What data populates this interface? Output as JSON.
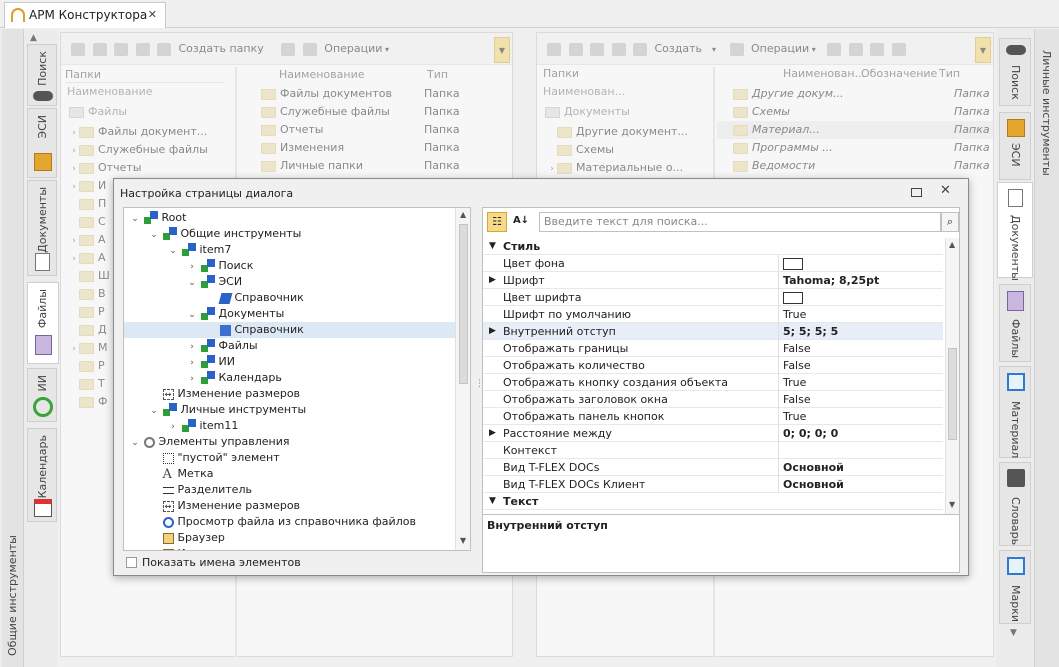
{
  "app": {
    "tab_title": "АРМ Конструктора",
    "close": "✕"
  },
  "left_side_tabs": [
    "Поиск",
    "ЭСИ",
    "Документы",
    "Файлы",
    "ИИ",
    "Календарь"
  ],
  "left_bottom_tab": "Общие инструменты",
  "right_top_tab": "Личные инструменты",
  "right_side_tabs": [
    "Поиск",
    "ЭСИ",
    "Документы",
    "Файлы",
    "Материал",
    "Словарь",
    "Марки"
  ],
  "left_panel": {
    "toolbar": {
      "create_folder": "Создать папку",
      "operations": "Операции"
    },
    "folders_header": "Папки",
    "name_header": "Наименование",
    "type_header": "Тип",
    "tree_root": "Файлы",
    "tree_items": [
      "Файлы документ...",
      "Служебные файлы",
      "Отчеты",
      "И",
      "П",
      "С",
      "А",
      "А",
      "Ш",
      "В",
      "Р",
      "Д",
      "М",
      "Р",
      "Т",
      "Ф"
    ],
    "rows": [
      {
        "name": "Файлы документов",
        "type": "Папка"
      },
      {
        "name": "Служебные файлы",
        "type": "Папка"
      },
      {
        "name": "Отчеты",
        "type": "Папка"
      },
      {
        "name": "Изменения",
        "type": "Папка"
      },
      {
        "name": "Личные папки",
        "type": "Папка"
      }
    ]
  },
  "right_panel": {
    "toolbar": {
      "create": "Создать",
      "operations": "Операции"
    },
    "folders_header": "Папки",
    "name_header": "Наименован...",
    "designation_header": "Обозначение",
    "type_header": "Тип",
    "tree_root": "Документы",
    "tree_items": [
      "Другие документ...",
      "Схемы",
      "Материальные о..."
    ],
    "rows": [
      {
        "name": "Другие докум...",
        "type": "Папка"
      },
      {
        "name": "Схемы",
        "type": "Папка"
      },
      {
        "name": "Материал...",
        "type": "Папка"
      },
      {
        "name": "Программы ...",
        "type": "Папка"
      },
      {
        "name": "Ведомости",
        "type": "Папка"
      }
    ]
  },
  "dialog": {
    "title": "Настройка страницы диалога",
    "show_names": "Показать имена элементов",
    "search_placeholder": "Введите текст для поиска...",
    "tree": [
      {
        "label": "Root",
        "level": 0,
        "exp": "v",
        "icon": "node"
      },
      {
        "label": "Общие инструменты",
        "level": 1,
        "exp": "v",
        "icon": "node"
      },
      {
        "label": "item7",
        "level": 2,
        "exp": "v",
        "icon": "node"
      },
      {
        "label": "Поиск",
        "level": 3,
        "exp": ">",
        "icon": "node"
      },
      {
        "label": "ЭСИ",
        "level": 3,
        "exp": "v",
        "icon": "node"
      },
      {
        "label": "Справочник",
        "level": 4,
        "exp": "",
        "icon": "book"
      },
      {
        "label": "Документы",
        "level": 3,
        "exp": "v",
        "icon": "node"
      },
      {
        "label": "Справочник",
        "level": 4,
        "exp": "",
        "icon": "blue",
        "selected": true
      },
      {
        "label": "Файлы",
        "level": 3,
        "exp": ">",
        "icon": "node"
      },
      {
        "label": "ИИ",
        "level": 3,
        "exp": ">",
        "icon": "node"
      },
      {
        "label": "Календарь",
        "level": 3,
        "exp": ">",
        "icon": "node"
      },
      {
        "label": "Изменение размеров",
        "level": 1,
        "exp": "",
        "icon": "resize"
      },
      {
        "label": "Личные инструменты",
        "level": 1,
        "exp": "v",
        "icon": "node"
      },
      {
        "label": "item11",
        "level": 2,
        "exp": ">",
        "icon": "node"
      },
      {
        "label": "Элементы управления",
        "level": 0,
        "exp": "v",
        "icon": "gear"
      },
      {
        "label": "\"пустой\" элемент",
        "level": 1,
        "exp": "",
        "icon": "dotted"
      },
      {
        "label": "Метка",
        "level": 1,
        "exp": "",
        "icon": "A"
      },
      {
        "label": "Разделитель",
        "level": 1,
        "exp": "",
        "icon": "line"
      },
      {
        "label": "Изменение размеров",
        "level": 1,
        "exp": "",
        "icon": "resize"
      },
      {
        "label": "Просмотр файла из справочника файлов",
        "level": 1,
        "exp": "",
        "icon": "mag"
      },
      {
        "label": "Браузер",
        "level": 1,
        "exp": "",
        "icon": "browser"
      },
      {
        "label": "И...",
        "level": 1,
        "exp": "",
        "icon": "browser"
      }
    ],
    "props": [
      {
        "type": "group",
        "name": "Стиль"
      },
      {
        "name": "Цвет фона",
        "value": "",
        "swatch": true
      },
      {
        "name": "Шрифт",
        "value": "Tahoma; 8,25pt",
        "bold": true,
        "expand": true
      },
      {
        "name": "Цвет шрифта",
        "value": "",
        "swatch": true
      },
      {
        "name": "Шрифт по умолчанию",
        "value": "True"
      },
      {
        "name": "Внутренний отступ",
        "value": "5; 5; 5; 5",
        "bold": true,
        "expand": true,
        "selected": true
      },
      {
        "name": "Отображать границы",
        "value": "False"
      },
      {
        "name": "Отображать количество",
        "value": "False"
      },
      {
        "name": "Отображать кнопку создания объекта",
        "value": "True"
      },
      {
        "name": "Отображать заголовок окна",
        "value": "False"
      },
      {
        "name": "Отображать панель кнопок",
        "value": "True"
      },
      {
        "name": "Расстояние между",
        "value": "0; 0; 0; 0",
        "bold": true,
        "expand": true
      },
      {
        "name": "Контекст",
        "value": ""
      },
      {
        "name": "Вид T-FLEX DOCs",
        "value": "Основной",
        "bold": true
      },
      {
        "name": "Вид T-FLEX DOCs Клиент",
        "value": "Основной",
        "bold": true
      },
      {
        "type": "group",
        "name": "Текст"
      }
    ],
    "description_title": "Внутренний отступ"
  }
}
